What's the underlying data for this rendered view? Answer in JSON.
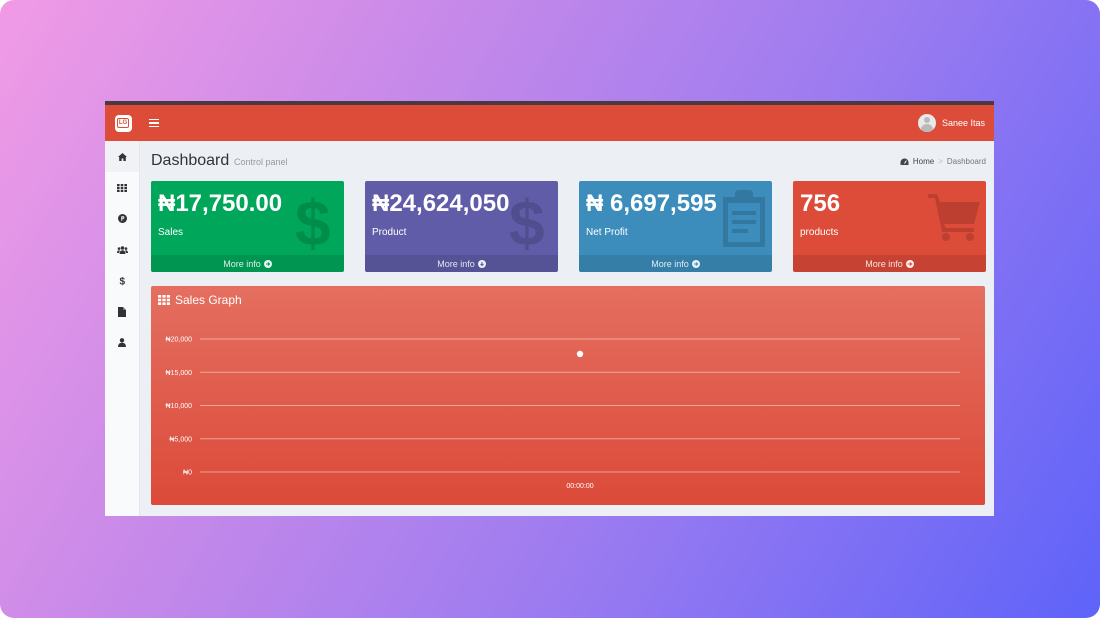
{
  "header": {
    "logo_text": "LG",
    "user_name": "Sanee Itas"
  },
  "sidebar": {
    "items": [
      {
        "icon": "home-icon"
      },
      {
        "icon": "grid-icon"
      },
      {
        "icon": "product-circle-icon"
      },
      {
        "icon": "users-icon"
      },
      {
        "icon": "dollar-icon"
      },
      {
        "icon": "file-icon"
      },
      {
        "icon": "user-icon"
      }
    ]
  },
  "page": {
    "title": "Dashboard",
    "subtitle": "Control panel",
    "breadcrumb_home": "Home",
    "breadcrumb_sep": ">",
    "breadcrumb_current": "Dashboard"
  },
  "stat_boxes": [
    {
      "value": "₦17,750.00",
      "label": "Sales",
      "link": "More info",
      "color": "#00a65a",
      "icon": "dollar-icon"
    },
    {
      "value": "₦24,624,050",
      "label": "Product",
      "link": "More info",
      "color": "#605ca8",
      "icon": "dollar-icon"
    },
    {
      "value": "₦ 6,697,595",
      "label": "Net Profit",
      "link": "More info",
      "color": "#3c8dbc",
      "icon": "clipboard-icon"
    },
    {
      "value": "756",
      "label": "products",
      "link": "More info",
      "color": "#dd4b39",
      "icon": "cart-icon"
    }
  ],
  "graph": {
    "title": "Sales Graph",
    "title_icon": "grid-icon"
  },
  "chart_data": {
    "type": "line",
    "title": "Sales Graph",
    "xlabel": "",
    "ylabel": "",
    "categories": [
      "00:00:00"
    ],
    "series": [
      {
        "values": [
          17750
        ]
      }
    ],
    "ylim": [
      0,
      20000
    ],
    "yticks": [
      "₦0",
      "₦5,000",
      "₦10,000",
      "₦15,000",
      "₦20,000"
    ],
    "grid": true
  }
}
